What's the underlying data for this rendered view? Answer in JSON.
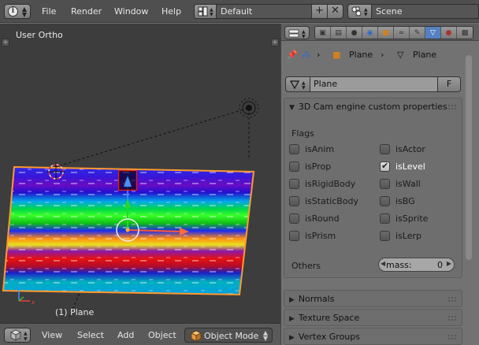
{
  "topbar": {
    "menus": [
      "File",
      "Render",
      "Window",
      "Help"
    ],
    "layout_name": "Default",
    "scene_name": "Scene"
  },
  "viewport": {
    "view_label": "User Ortho",
    "object_label": "(1) Plane"
  },
  "viewport_header": {
    "menus": [
      "View",
      "Select",
      "Add",
      "Object"
    ],
    "mode": "Object Mode"
  },
  "properties": {
    "breadcrumb": {
      "object": "Plane",
      "mesh": "Plane"
    },
    "mesh_name": "Plane",
    "fake_user_label": "F",
    "custom_panel_title": "3D Cam engine custom properties",
    "flags_label": "Flags",
    "flags_left": [
      {
        "label": "isAnim",
        "checked": false
      },
      {
        "label": "isProp",
        "checked": false
      },
      {
        "label": "isRigidBody",
        "checked": false
      },
      {
        "label": "isStaticBody",
        "checked": false
      },
      {
        "label": "isRound",
        "checked": false
      },
      {
        "label": "isPrism",
        "checked": false
      }
    ],
    "flags_right": [
      {
        "label": "isActor",
        "checked": false
      },
      {
        "label": "isLevel",
        "checked": true
      },
      {
        "label": "isWall",
        "checked": false
      },
      {
        "label": "isBG",
        "checked": false
      },
      {
        "label": "isSprite",
        "checked": false
      },
      {
        "label": "isLerp",
        "checked": false
      }
    ],
    "others_label": "Others",
    "mass_label": "mass:",
    "mass_value": "0",
    "collapsed_panels": [
      "Normals",
      "Texture Space",
      "Vertex Groups"
    ]
  },
  "colors": {
    "active_tab": "#5680c2",
    "selection_outline": "#ff9a2e"
  }
}
